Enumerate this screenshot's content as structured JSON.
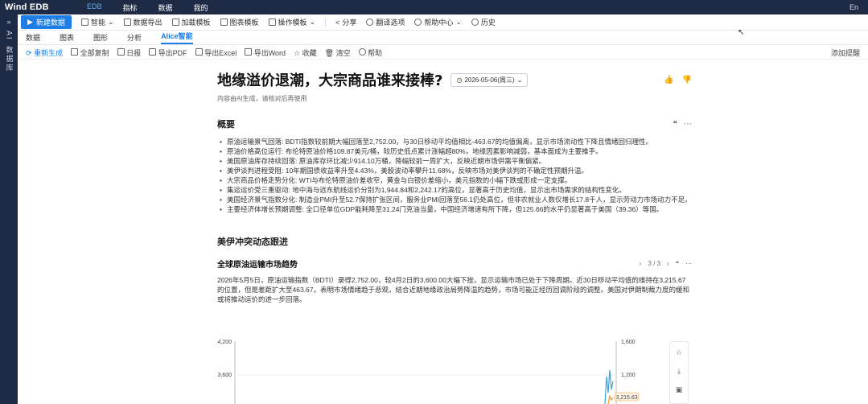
{
  "topbar": {
    "logo": "Wind EDB",
    "nav": [
      "EDB",
      "指标",
      "数据",
      "我的"
    ],
    "lang": "En"
  },
  "leftbar": {
    "expand": "»",
    "item1": "AI",
    "item2": "数据库"
  },
  "toolbar1": {
    "new_btn": "新建数据",
    "items": [
      "智能",
      "数据导出",
      "加载模板",
      "图表模板",
      "操作模板",
      "分享",
      "翻译选项",
      "帮助中心",
      "历史"
    ]
  },
  "tabs": [
    "数据",
    "图表",
    "图形",
    "分析",
    "Alice智能"
  ],
  "toolbar3": {
    "items": [
      "重新生成",
      "全部复制",
      "日报",
      "导出PDF",
      "导出Excel",
      "导出Word",
      "收藏",
      "清空",
      "帮助"
    ],
    "right": "添加提醒"
  },
  "article": {
    "title": "地缘溢价退潮，大宗商品谁来接棒?",
    "date": "2026-05-06(周三)",
    "subnote": "内容由AI生成，请核对后再使用",
    "summary_title": "概要",
    "summary_items": [
      "原油运输景气回落: BDTI指数较前期大幅回落至2,752.00，与30日移动平均值相比-463.67的均值偏离，显示市场流动性下降且情绪回归理性。",
      "原油价格高位运行: 布伦特原油价格109.87美元/桶，较历史低点累计涨幅超80%，地缘因素影响减弱，基本面成为主要推手。",
      "美国原油库存持续回落: 原油库存环比减少914.10万桶，降幅较前一周扩大，反映近期市场供需平衡偏紧。",
      "美伊谈判进程受阻: 10年期国债收益率升至4.43%，美股波动率攀升11.68%，反映市场对美伊谈判的不确定性预期升温。",
      "大宗商品价格走势分化: WTI与布伦特原油价差收窄，黄金与白银价差缩小，美元指数的小幅下跌或形成一定支撑。",
      "集运运价受三重驱动: 地中海与远东航线运价分别为1,944.84和2,242.17的高位，显著高于历史均值，显示出市场需求的结构性变化。",
      "美国经济景气指数分化: 制造业PMI升至52.7保持扩张区间，服务业PMI回落至56.1仍处高位，但非农就业人数仅增长17.8千人，显示劳动力市场动力不足。",
      "主要经济体增长预期调整: 全口径单位GDP能耗降至31.24门克油当量，中国经济增速有所下降，但125.66的水平仍显著高于美国（39.36）等国。"
    ],
    "section2_title": "美伊冲突动态跟进",
    "sub_title": "全球原油运输市场趋势",
    "pager": "3 / 3",
    "paragraph": "2026年5月5日，原油运输指数（BDTI）录得2,752.00，较4月2日的3,600.00大幅下挫，显示运输市场已处于下降周期。近30日移动平均值的维持在3,215.67的位置，但是差距扩大至463.67，表明市场情绪趋于悲观，结合近期地缘政治局势降温的趋势，市场可能正经历回调阶段的调整。美国对伊朗制裁力度的缓和或将推动运价的进一步回落。"
  },
  "chart_data": {
    "type": "line",
    "y_left_ticks": [
      "4,200",
      "3,600"
    ],
    "y_right_ticks": [
      "1,600",
      "1,200"
    ],
    "last_value_label": "3,215.63"
  },
  "rail": {
    "icons": [
      "star-icon",
      "download-icon",
      "image-icon"
    ]
  }
}
